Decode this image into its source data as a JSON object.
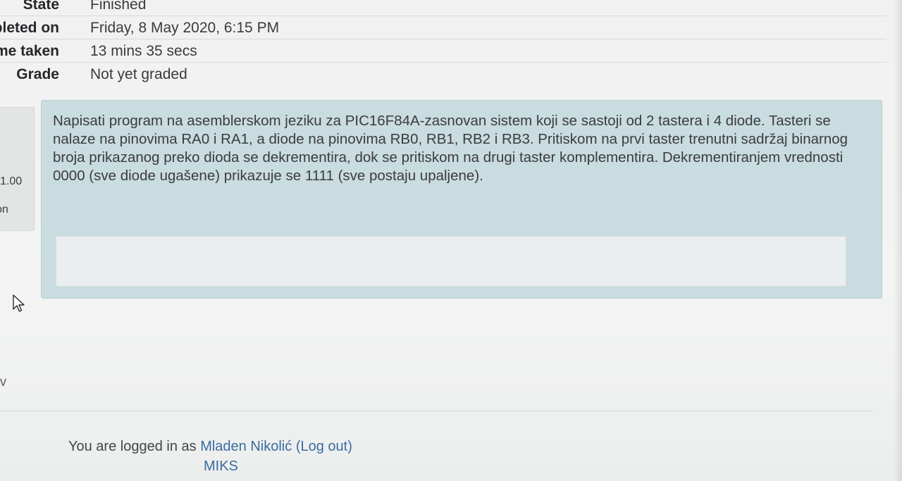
{
  "summary": {
    "rows": [
      {
        "label": "State",
        "value": "Finished"
      },
      {
        "label": "Completed on",
        "value": "Friday, 8 May 2020, 6:15 PM"
      },
      {
        "label": "Time taken",
        "value": "13 mins 35 secs"
      },
      {
        "label": "Grade",
        "value": "Not yet graded"
      }
    ]
  },
  "question_info": {
    "marks": "1.00",
    "flag": "on"
  },
  "question": {
    "text": "Napisati program na asemblerskom jeziku za PIC16F84A-zasnovan sistem koji se sastoji od 2 tastera i 4 diode. Tasteri se nalaze na pinovima RA0 i RA1, a diode na pinovima RB0, RB1, RB2 i RB3. Pritiskom na prvi taster trenutni sadržaj binarnog broja prikazanog preko dioda se dekrementira, dok se pritiskom na drugi taster komplementira. Dekrementiranjem vrednosti 0000 (sve diode ugašene) prikazuje se 1111 (sve postaju upaljene).",
    "answer": ""
  },
  "nav": {
    "marker": "v"
  },
  "footer": {
    "logged_in_prefix": "You are logged in as",
    "user_name": "Mladen Nikolić",
    "logout_label": "(Log out)",
    "course": "MIKS"
  },
  "icons": {
    "cursor": "mouse-pointer-icon"
  }
}
